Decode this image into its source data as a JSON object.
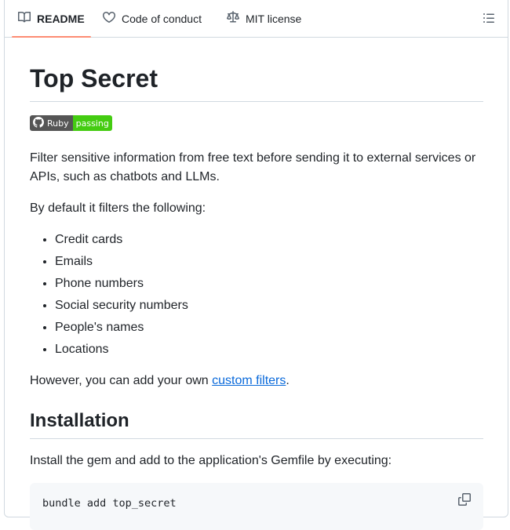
{
  "tabs": [
    {
      "label": "README",
      "icon": "book-icon",
      "active": true
    },
    {
      "label": "Code of conduct",
      "icon": "heart-handshake-icon",
      "active": false
    },
    {
      "label": "MIT license",
      "icon": "law-scale-icon",
      "active": false
    }
  ],
  "outline_icon": "list-unordered-icon",
  "readme": {
    "title": "Top Secret",
    "badge": {
      "label": "Ruby",
      "status": "passing",
      "status_color": "#4c1"
    },
    "intro": "Filter sensitive information from free text before sending it to external services or APIs, such as chatbots and LLMs.",
    "default_filters_intro": "By default it filters the following:",
    "filters": [
      "Credit cards",
      "Emails",
      "Phone numbers",
      "Social security numbers",
      "People's names",
      "Locations"
    ],
    "custom_prefix": "However, you can add your own ",
    "custom_link": "custom filters",
    "custom_suffix": ".",
    "installation_heading": "Installation",
    "installation_text": "Install the gem and add to the application's Gemfile by executing:",
    "install_command": "bundle add top_secret"
  },
  "colors": {
    "accent_underline": "#fd8c73",
    "link": "#0969da",
    "code_bg": "#f6f8fa"
  }
}
